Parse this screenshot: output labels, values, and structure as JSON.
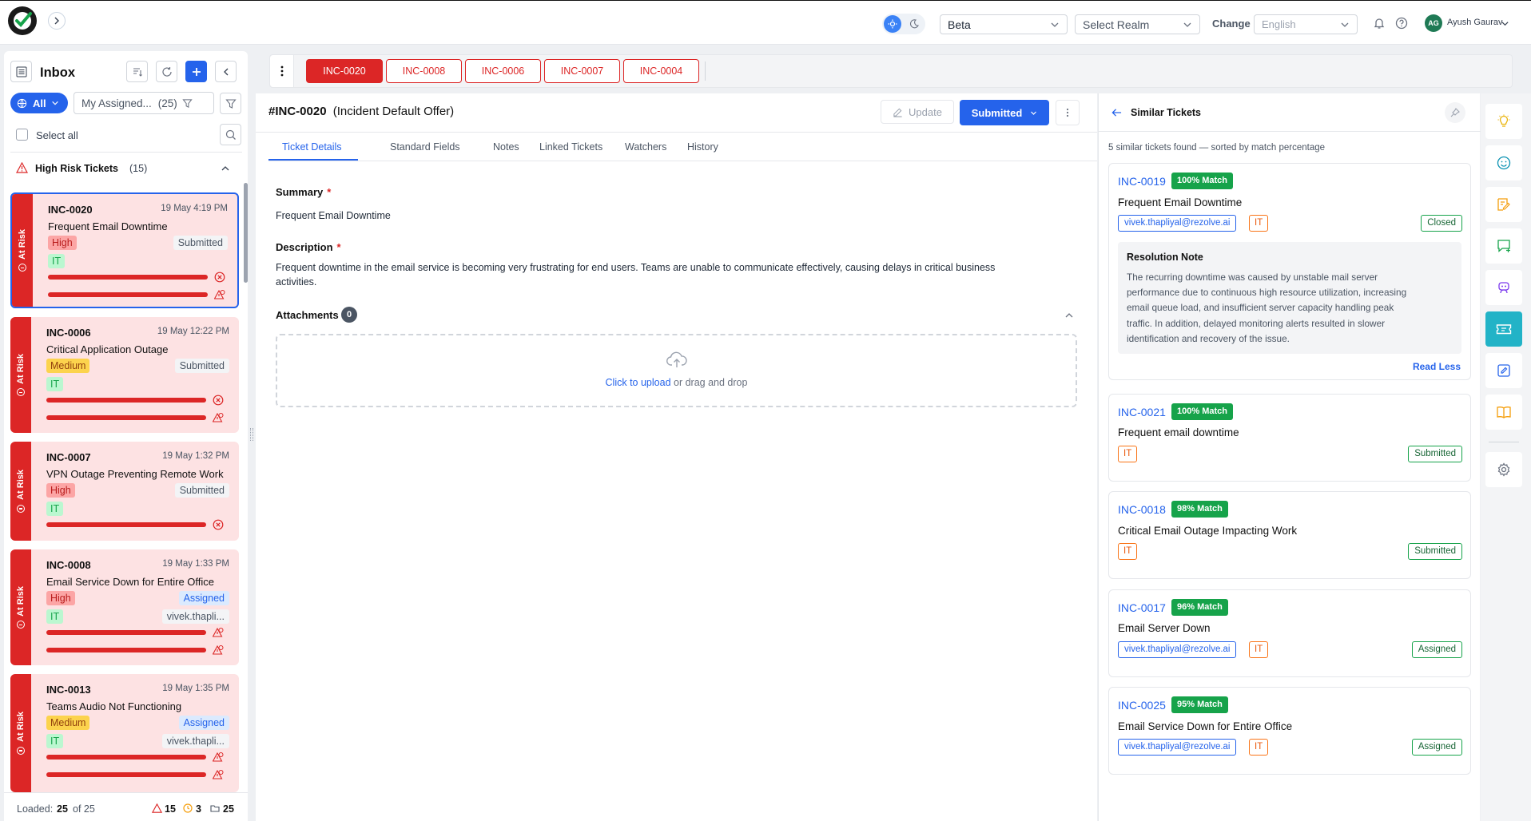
{
  "topbar": {
    "env": "Beta",
    "realm_placeholder": "Select Realm",
    "change_label": "Change",
    "language": "English",
    "user_initials": "AG",
    "user_name": "Ayush Gaurav"
  },
  "sidebar": {
    "title": "Inbox",
    "filter_all": "All",
    "my_assigned": "My Assigned...",
    "my_assigned_count": "(25)",
    "select_all": "Select all",
    "group_title": "High Risk Tickets",
    "group_count": "(15)",
    "risk_label": "At Risk",
    "tickets": [
      {
        "id": "INC-0020",
        "date": "19 May 4:19 PM",
        "title": "Frequent Email Downtime",
        "priority": "High",
        "status": "Submitted",
        "category": "IT",
        "assignee": ""
      },
      {
        "id": "INC-0006",
        "date": "19 May 12:22 PM",
        "title": "Critical Application Outage",
        "priority": "Medium",
        "status": "Submitted",
        "category": "IT",
        "assignee": ""
      },
      {
        "id": "INC-0007",
        "date": "19 May 1:32 PM",
        "title": "VPN Outage Preventing Remote Work",
        "priority": "High",
        "status": "Submitted",
        "category": "IT",
        "assignee": ""
      },
      {
        "id": "INC-0008",
        "date": "19 May 1:33 PM",
        "title": "Email Service Down for Entire Office",
        "priority": "High",
        "status": "Assigned",
        "category": "IT",
        "assignee": "vivek.thapli..."
      },
      {
        "id": "INC-0013",
        "date": "19 May 1:35 PM",
        "title": "Teams Audio Not Functioning",
        "priority": "Medium",
        "status": "Assigned",
        "category": "IT",
        "assignee": "vivek.thapli..."
      }
    ],
    "footer": {
      "loaded_label": "Loaded:",
      "loaded": "25",
      "of": "of 25",
      "risk": "15",
      "warn": "3",
      "total": "25"
    }
  },
  "tabs": [
    "INC-0020",
    "INC-0008",
    "INC-0006",
    "INC-0007",
    "INC-0004"
  ],
  "ticket": {
    "id": "#INC-0020",
    "offer": "(Incident Default Offer)",
    "update_label": "Update",
    "status_button": "Submitted",
    "subtabs": [
      "Ticket Details",
      "Standard Fields",
      "Notes",
      "Linked Tickets",
      "Watchers",
      "History"
    ],
    "summary_label": "Summary",
    "summary": "Frequent Email Downtime",
    "description_label": "Description",
    "description_1": "Frequent downtime in the email service is becoming very frustrating for end users. Teams are unable to communicate effectively, causing delays in critical business",
    "description_2": "activities.",
    "attachments_label": "Attachments",
    "attachments_count": "0",
    "upload_link": "Click to upload",
    "upload_rest": "or drag and drop"
  },
  "similar": {
    "title": "Similar Tickets",
    "subtitle": "5 similar tickets found — sorted by match percentage",
    "resolution_title": "Resolution Note",
    "resolution_lines": [
      "The recurring downtime was caused by unstable mail server",
      "performance due to continuous high resource utilization, increasing",
      "email queue load, and insufficient server capacity handling peak",
      "traffic. In addition, delayed monitoring alerts resulted in slower",
      "identification and recovery of the issue."
    ],
    "read_less": "Read Less",
    "items": [
      {
        "id": "INC-0019",
        "match": "100% Match",
        "title": "Frequent Email Downtime",
        "email": "vivek.thapliyal@rezolve.ai",
        "category": "IT",
        "status": "Closed"
      },
      {
        "id": "INC-0021",
        "match": "100% Match",
        "title": "Frequent email downtime",
        "email": "",
        "category": "IT",
        "status": "Submitted"
      },
      {
        "id": "INC-0018",
        "match": "98% Match",
        "title": "Critical Email Outage Impacting Work",
        "email": "",
        "category": "IT",
        "status": "Submitted"
      },
      {
        "id": "INC-0017",
        "match": "96% Match",
        "title": "Email Server Down",
        "email": "vivek.thapliyal@rezolve.ai",
        "category": "IT",
        "status": "Assigned"
      },
      {
        "id": "INC-0025",
        "match": "95% Match",
        "title": "Email Service Down for Entire Office",
        "email": "vivek.thapliyal@rezolve.ai",
        "category": "IT",
        "status": "Assigned"
      }
    ]
  }
}
